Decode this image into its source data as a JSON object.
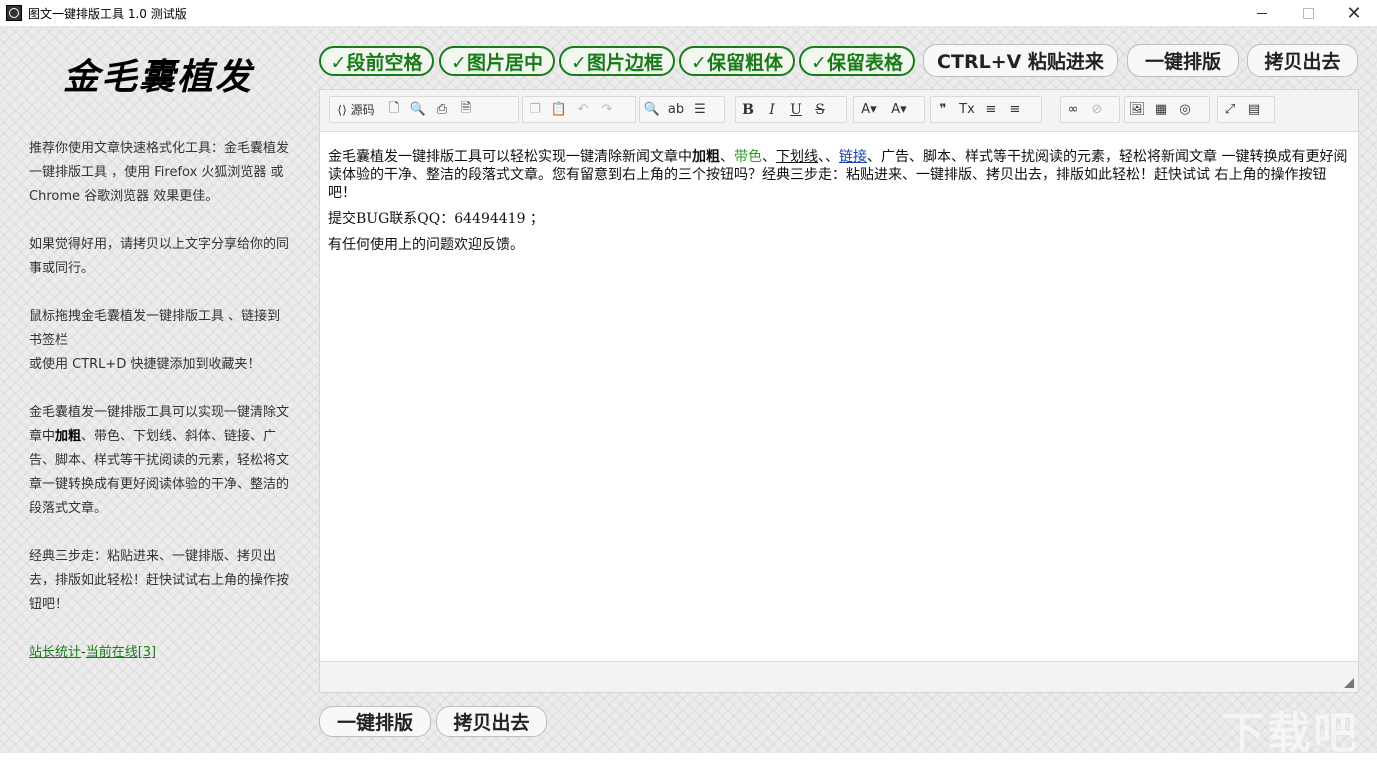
{
  "window": {
    "title": "图文一键排版工具 1.0 测试版",
    "minimize_label": "",
    "maximize_label": "",
    "close_label": "✕"
  },
  "sidebar": {
    "logo": "金毛囊植发",
    "para1": "推荐你使用文章快速格式化工具：金毛囊植发一键排版工具 ，使用 Firefox 火狐浏览器 或 Chrome 谷歌浏览器 效果更佳。",
    "para2": "如果觉得好用，请拷贝以上文字分享给你的同事或同行。",
    "para3a": "鼠标拖拽金毛囊植发一键排版工具 、链接到书签栏",
    "para3b": "或使用 CTRL+D 快捷键添加到收藏夹！",
    "para4_pre": "金毛囊植发一键排版工具可以实现一键清除文章中",
    "para4_bold": "加粗",
    "para4_post": "、带色、下划线、斜体、链接、广告、脚本、样式等干扰阅读的元素，轻松将文章一键转换成有更好阅读体验的干净、整洁的段落式文章。",
    "para5": "经典三步走：粘贴进来、一键排版、拷贝出去，排版如此轻松！赶快试试右上角的操作按钮吧！",
    "link_stats": "站长统计",
    "link_sep": "-",
    "link_online": "当前在线[3]"
  },
  "top_buttons": {
    "toggle1": "✓段前空格",
    "toggle2": "✓图片居中",
    "toggle3": "✓图片边框",
    "toggle4": "✓保留粗体",
    "toggle5": "✓保留表格",
    "paste": "CTRL+V 粘贴进来",
    "format": "一键排版",
    "copy": "拷贝出去"
  },
  "toolbar": {
    "source": "源码",
    "icons": {
      "newdoc": "🗋",
      "preview": "🔍",
      "print": "⎙",
      "template": "🗎",
      "copy": "❐",
      "paste": "📋",
      "undo": "↶",
      "redo": "↷",
      "find": "🔍",
      "replace": "ab",
      "selectall": "☰",
      "bold": "B",
      "italic": "I",
      "underline": "U",
      "strike": "S",
      "fontcolor": "A▾",
      "bgcolor": "A▾",
      "quote": "❞",
      "removeformat": "Tx",
      "alignleft": "≡",
      "alignright": "≡",
      "link": "∞",
      "unlink": "⊘",
      "image": "🖼",
      "table": "▦",
      "globe": "◎",
      "maximize": "⤢",
      "showblocks": "▤"
    }
  },
  "content": {
    "p1_a": "金毛囊植发一键排版工具可以轻松实现一键清除新闻文章中",
    "p1_bold": "加粗",
    "p1_sep1": "、",
    "p1_green": "带色",
    "p1_sep2": "、",
    "p1_under": "下划线",
    "p1_sep3": "、、",
    "p1_link": "链接",
    "p1_b": "、广告、脚本、样式等干扰阅读的元素，轻松将新闻文章 一键转换成有更好阅读体验的干净、整洁的段落式文章。您有留意到右上角的三个按钮吗？经典三步走：粘贴进来、一键排版、拷贝出去，排版如此轻松！赶快试试 右上角的操作按钮吧！",
    "p2": "提交BUG联系QQ：64494419 ；",
    "p3": "有任何使用上的问题欢迎反馈。"
  },
  "bottom_buttons": {
    "format": "一键排版",
    "copy": "拷贝出去"
  },
  "watermark": "下载吧",
  "colors": {
    "accent_green": "#1a7a1a",
    "link_blue": "#1a44a8"
  }
}
